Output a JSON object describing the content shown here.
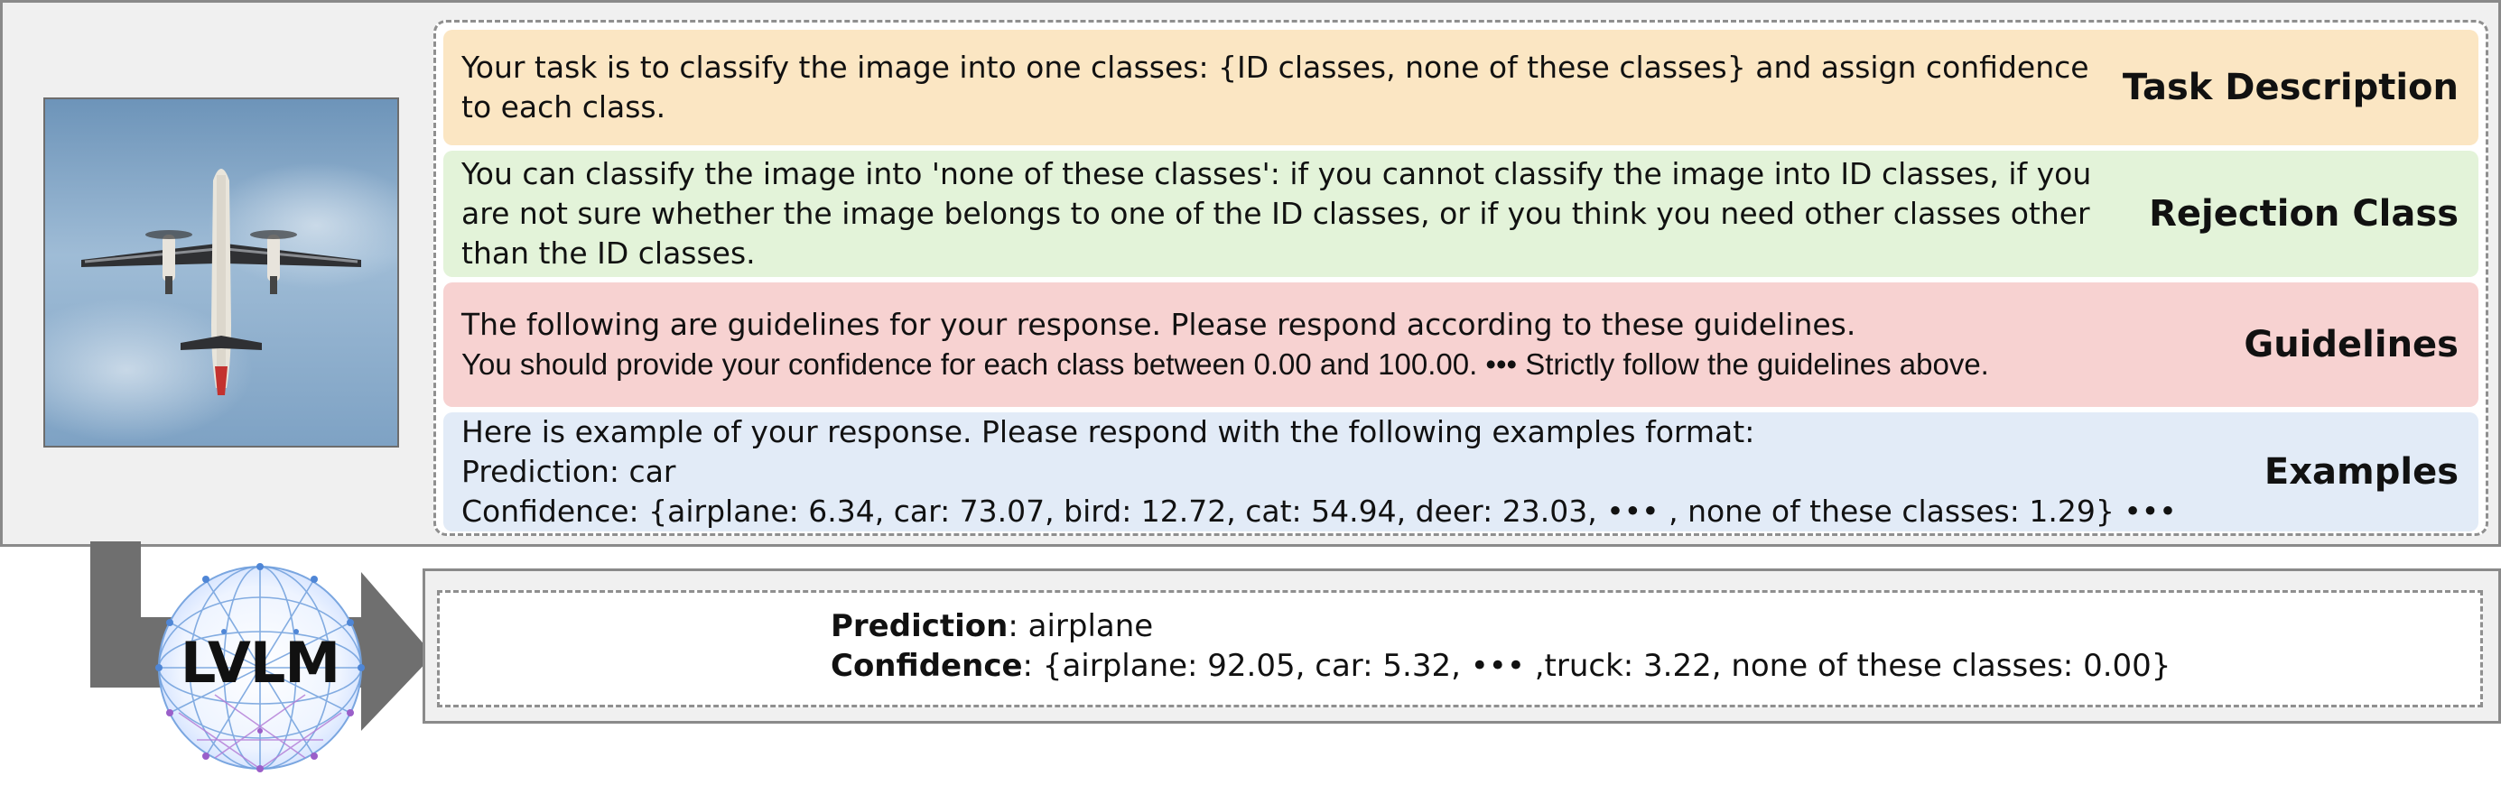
{
  "prompt": {
    "task": {
      "lines": [
        "Your task is to classify the image into one classes: {ID classes, none of these classes} and assign confidence",
        "to each class."
      ],
      "label": "Task Description"
    },
    "rejection": {
      "lines": [
        "You can classify the image into 'none of these classes': if you cannot classify the image into ID classes, if you",
        "are not sure whether the image belongs to one of the ID classes, or if you think you need other classes other",
        "than the ID classes."
      ],
      "label": "Rejection Class"
    },
    "guidelines": {
      "lines": [
        "The following are guidelines for your response. Please respond according to these guidelines.",
        "You should provide your confidence for each class between 0.00 and 100.00. ••• Strictly follow the guidelines above."
      ],
      "label": "Guidelines"
    },
    "examples": {
      "lines": [
        "Here is example of your response. Please respond with the following examples format:",
        "Prediction: car",
        "Confidence: {airplane: 6.34, car: 73.07, bird: 12.72, cat: 54.94, deer: 23.03, ••• , none of these classes: 1.29} •••"
      ],
      "label": "Examples"
    }
  },
  "model": {
    "label": "LVLM"
  },
  "output": {
    "prediction_key": "Prediction",
    "prediction_value": ": airplane",
    "confidence_key": "Confidence",
    "confidence_value": ": {airplane: 92.05, car: 5.32, ••• ,truck: 3.22, none of these classes: 0.00}"
  },
  "colors": {
    "task_bg": "#fbe6c3",
    "rejection_bg": "#e3f3d9",
    "guidelines_bg": "#f7d2d1",
    "examples_bg": "#e2ebf7",
    "arrow": "#6f6f6f"
  },
  "icons": {
    "input_image": "airplane-photo",
    "model_icon": "network-sphere-icon"
  }
}
